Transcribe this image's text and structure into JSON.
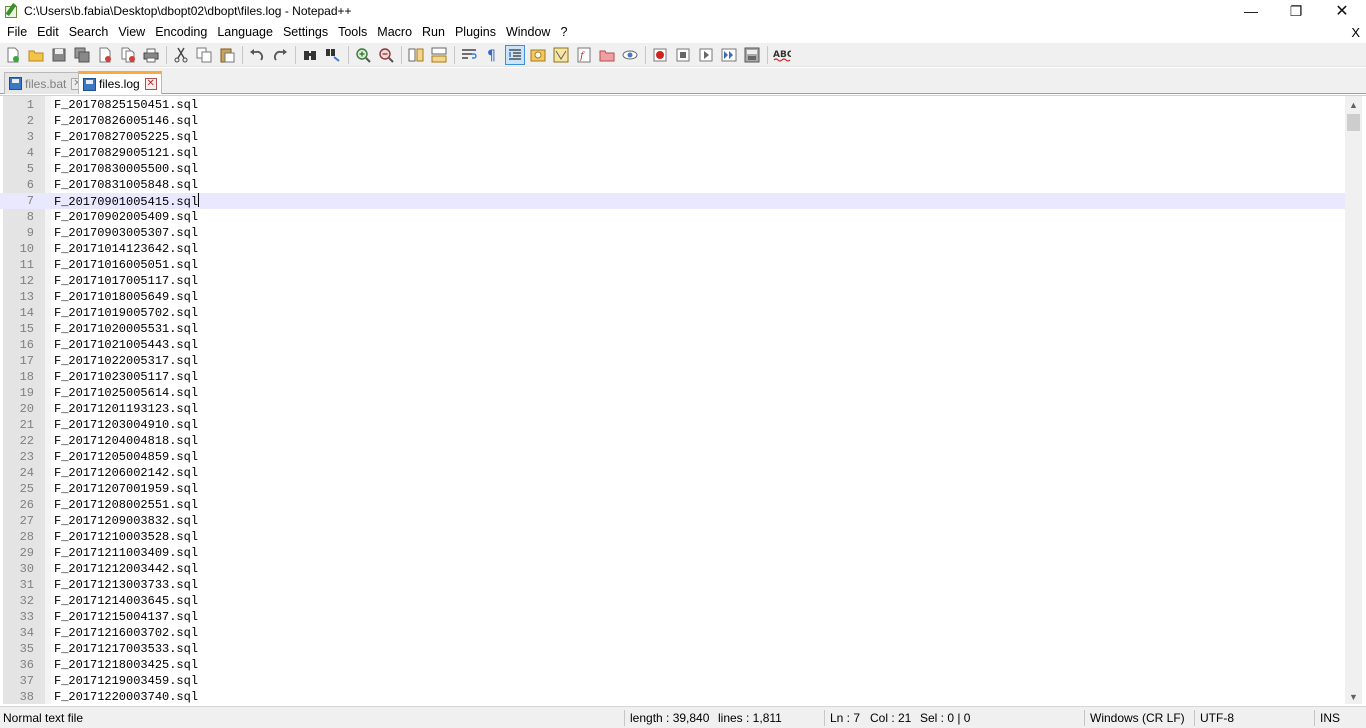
{
  "window": {
    "title": "C:\\Users\\b.fabia\\Desktop\\dbopt02\\dbopt\\files.log - Notepad++",
    "min_glyph": "—",
    "max_glyph": "❐",
    "close_glyph": "✕"
  },
  "menu": {
    "items": [
      "File",
      "Edit",
      "Search",
      "View",
      "Encoding",
      "Language",
      "Settings",
      "Tools",
      "Macro",
      "Run",
      "Plugins",
      "Window",
      "?"
    ],
    "close_doc": "X"
  },
  "toolbar": {
    "icons": [
      "new-file-icon",
      "open-file-icon",
      "save-icon",
      "save-all-icon",
      "close-icon",
      "close-all-icon",
      "print-icon",
      "cut-icon",
      "copy-icon",
      "paste-icon",
      "undo-icon",
      "redo-icon",
      "find-icon",
      "replace-icon",
      "zoom-in-icon",
      "zoom-out-icon",
      "sync-vertical-icon",
      "sync-horizontal-icon",
      "word-wrap-icon",
      "show-all-chars-icon",
      "indent-guide-icon",
      "user-defined-language-icon",
      "doc-map-icon",
      "function-list-icon",
      "folder-as-workspace-icon",
      "monitoring-icon",
      "record-macro-icon",
      "stop-recording-icon",
      "playback-macro-icon",
      "run-macro-multiple-icon",
      "save-macro-icon",
      "spell-check-icon"
    ]
  },
  "tabs": [
    {
      "label": "files.bat",
      "active": false
    },
    {
      "label": "files.log",
      "active": true
    }
  ],
  "editor": {
    "current_line": 7,
    "lines": [
      "F_20170825150451.sql",
      "F_20170826005146.sql",
      "F_20170827005225.sql",
      "F_20170829005121.sql",
      "F_20170830005500.sql",
      "F_20170831005848.sql",
      "F_20170901005415.sql",
      "F_20170902005409.sql",
      "F_20170903005307.sql",
      "F_20171014123642.sql",
      "F_20171016005051.sql",
      "F_20171017005117.sql",
      "F_20171018005649.sql",
      "F_20171019005702.sql",
      "F_20171020005531.sql",
      "F_20171021005443.sql",
      "F_20171022005317.sql",
      "F_20171023005117.sql",
      "F_20171025005614.sql",
      "F_20171201193123.sql",
      "F_20171203004910.sql",
      "F_20171204004818.sql",
      "F_20171205004859.sql",
      "F_20171206002142.sql",
      "F_20171207001959.sql",
      "F_20171208002551.sql",
      "F_20171209003832.sql",
      "F_20171210003528.sql",
      "F_20171211003409.sql",
      "F_20171212003442.sql",
      "F_20171213003733.sql",
      "F_20171214003645.sql",
      "F_20171215004137.sql",
      "F_20171216003702.sql",
      "F_20171217003533.sql",
      "F_20171218003425.sql",
      "F_20171219003459.sql",
      "F_20171220003740.sql"
    ]
  },
  "scrollbar": {
    "up_glyph": "▲",
    "down_glyph": "▼"
  },
  "status": {
    "type": "Normal text file",
    "length": "length : 39,840",
    "lines": "lines : 1,811",
    "ln": "Ln : 7",
    "col": "Col : 21",
    "sel": "Sel : 0 | 0",
    "eol": "Windows (CR LF)",
    "encoding": "UTF-8",
    "mode": "INS"
  },
  "colors": {
    "current_line_bg": "#e8e8ff",
    "tab_active_accent": "#faaa3c",
    "gutter_bg": "#e4e4e4"
  }
}
